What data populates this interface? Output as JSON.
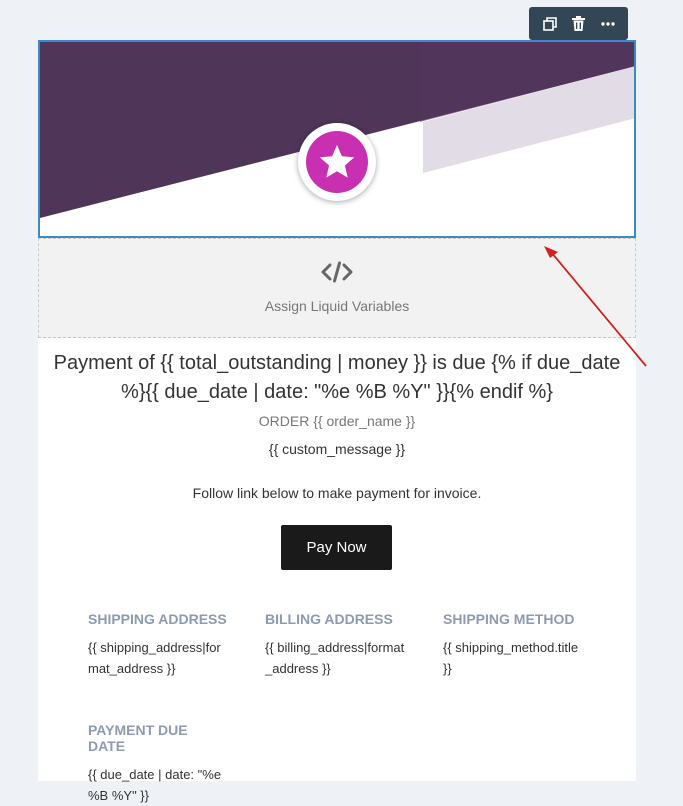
{
  "toolbar": {
    "icons": [
      "duplicate-icon",
      "trash-icon",
      "more-icon"
    ],
    "bg_color": "#334655"
  },
  "hero": {
    "primary_color": "#4f3558",
    "logo_color": "#c92fb1",
    "logo_icon": "star-icon",
    "border_color": "#3a8bc4"
  },
  "liquid_block": {
    "icon": "code-icon",
    "label": "Assign Liquid Variables"
  },
  "email": {
    "title": "Payment of {{ total_outstanding | money }} is due {% if due_date %}{{ due_date | date: \"%e %B %Y\" }}{% endif %}",
    "order": "ORDER {{ order_name }}",
    "custom_message": "{{ custom_message }}",
    "follow_text": "Follow link below to make payment for invoice.",
    "pay_button": "Pay Now"
  },
  "info": {
    "shipping_address": {
      "heading": "SHIPPING ADDRESS",
      "value": "{{ shipping_address|format_address }}"
    },
    "billing_address": {
      "heading": "BILLING ADDRESS",
      "value": "{{ billing_address|format_address }}"
    },
    "shipping_method": {
      "heading": "SHIPPING METHOD",
      "value": "{{ shipping_method.title }}"
    },
    "payment_due_date": {
      "heading": "PAYMENT DUE DATE",
      "value": "{{ due_date | date: \"%e %B %Y\" }}"
    }
  },
  "annotation": {
    "arrow_color": "#d32020"
  }
}
